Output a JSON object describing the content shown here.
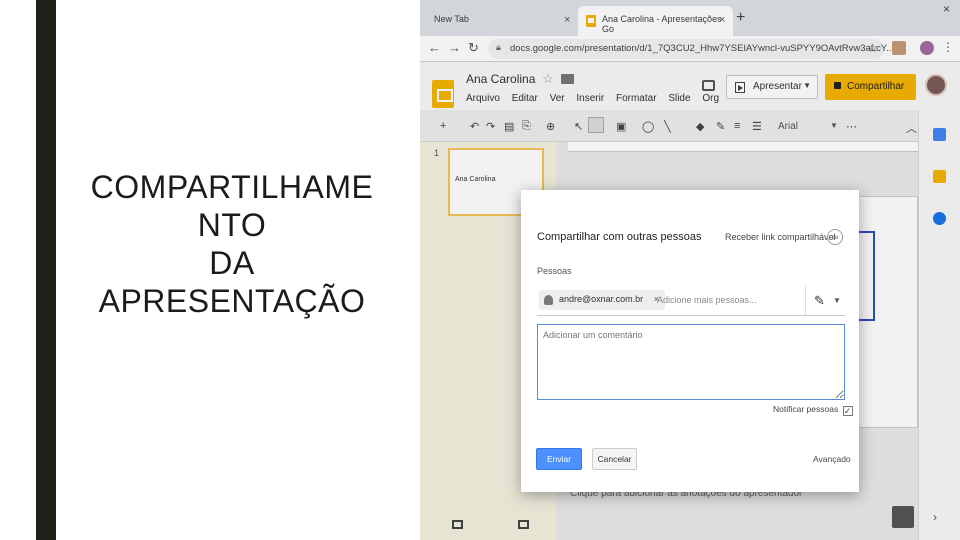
{
  "slide": {
    "title_lines": [
      "COMPARTILHAME",
      "NTO",
      "DA",
      "APRESENTAÇÃO"
    ]
  },
  "browser": {
    "tabs": [
      {
        "label": "New Tab"
      },
      {
        "label": "Ana Carolina - Apresentações Go"
      }
    ],
    "url": "docs.google.com/presentation/d/1_7Q3CU2_Hhw7YSEIAYwncl-vuSPYY9OAvtRvw3aLcY..."
  },
  "slides_app": {
    "doc_title": "Ana Carolina",
    "menu": [
      "Arquivo",
      "Editar",
      "Ver",
      "Inserir",
      "Formatar",
      "Slide",
      "Org"
    ],
    "present_label": "Apresentar",
    "share_label": "Compartilhar",
    "font_name": "Arial",
    "thumb_number": "1",
    "thumb_text": "Ana Carolina",
    "notes_placeholder": "Clique para adicionar as anotações do apresentador"
  },
  "share_dialog": {
    "title": "Compartilhar com outras pessoas",
    "link_label": "Receber link compartilhável",
    "people_label": "Pessoas",
    "chip_email": "andre@oxnar.com.br",
    "add_more_placeholder": "Adicione mais pessoas...",
    "comment_placeholder": "Adicionar um comentário",
    "notify_label": "Notificar pessoas",
    "send_label": "Enviar",
    "cancel_label": "Cancelar",
    "advanced_label": "Avançado"
  },
  "icons": {
    "slides_favicon": "google-slides-icon",
    "share_lock": "lock-icon",
    "link": "link-icon",
    "pencil": "pencil-icon"
  },
  "colors": {
    "accent_yellow": "#f4b400",
    "send_blue": "#4d90fe",
    "dark_bar": "#1f2018"
  }
}
